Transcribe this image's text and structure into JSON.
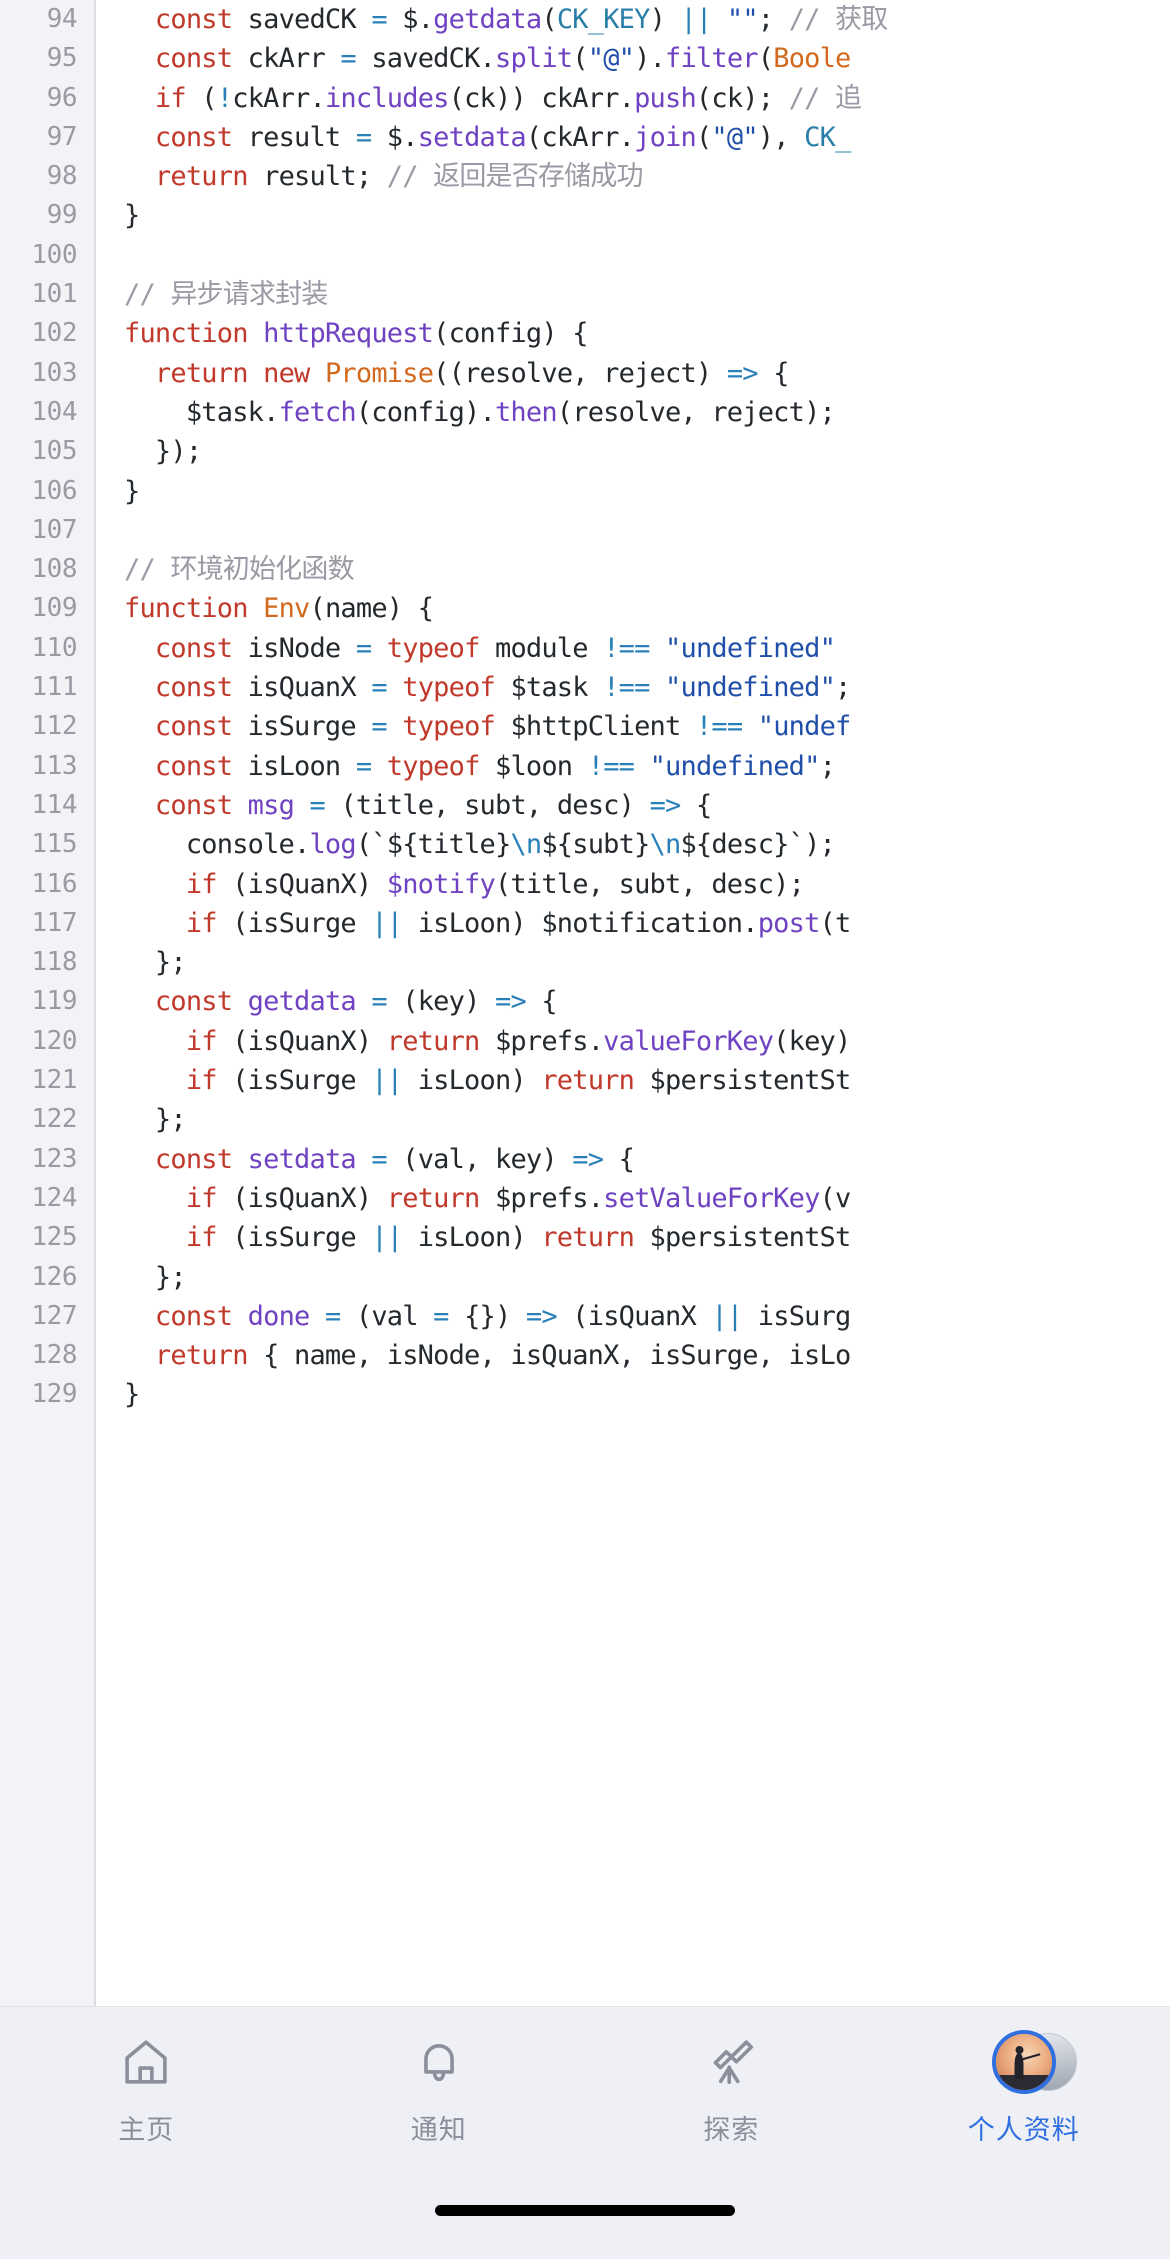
{
  "editor": {
    "first_line_number": 94,
    "lines": [
      {
        "n": 94,
        "tokens": [
          {
            "t": "  ",
            "c": "t-var"
          },
          {
            "t": "const",
            "c": "t-kw"
          },
          {
            "t": " savedCK ",
            "c": "t-var"
          },
          {
            "t": "=",
            "c": "t-op"
          },
          {
            "t": " $.",
            "c": "t-var"
          },
          {
            "t": "getdata",
            "c": "t-fn"
          },
          {
            "t": "(",
            "c": "t-var"
          },
          {
            "t": "CK_KEY",
            "c": "t-cnst"
          },
          {
            "t": ") ",
            "c": "t-var"
          },
          {
            "t": "||",
            "c": "t-op"
          },
          {
            "t": " ",
            "c": "t-var"
          },
          {
            "t": "\"\"",
            "c": "t-str"
          },
          {
            "t": "; ",
            "c": "t-var"
          },
          {
            "t": "// 获取",
            "c": "t-cmt"
          }
        ]
      },
      {
        "n": 95,
        "tokens": [
          {
            "t": "  ",
            "c": "t-var"
          },
          {
            "t": "const",
            "c": "t-kw"
          },
          {
            "t": " ckArr ",
            "c": "t-var"
          },
          {
            "t": "=",
            "c": "t-op"
          },
          {
            "t": " savedCK.",
            "c": "t-var"
          },
          {
            "t": "split",
            "c": "t-fn"
          },
          {
            "t": "(",
            "c": "t-var"
          },
          {
            "t": "\"@\"",
            "c": "t-str"
          },
          {
            "t": ").",
            "c": "t-var"
          },
          {
            "t": "filter",
            "c": "t-fn"
          },
          {
            "t": "(",
            "c": "t-var"
          },
          {
            "t": "Boole",
            "c": "t-cls"
          }
        ]
      },
      {
        "n": 96,
        "tokens": [
          {
            "t": "  ",
            "c": "t-var"
          },
          {
            "t": "if",
            "c": "t-kw"
          },
          {
            "t": " (",
            "c": "t-var"
          },
          {
            "t": "!",
            "c": "t-op"
          },
          {
            "t": "ckArr.",
            "c": "t-var"
          },
          {
            "t": "includes",
            "c": "t-fn"
          },
          {
            "t": "(ck)) ckArr.",
            "c": "t-var"
          },
          {
            "t": "push",
            "c": "t-fn"
          },
          {
            "t": "(ck); ",
            "c": "t-var"
          },
          {
            "t": "// 追",
            "c": "t-cmt"
          }
        ]
      },
      {
        "n": 97,
        "tokens": [
          {
            "t": "  ",
            "c": "t-var"
          },
          {
            "t": "const",
            "c": "t-kw"
          },
          {
            "t": " result ",
            "c": "t-var"
          },
          {
            "t": "=",
            "c": "t-op"
          },
          {
            "t": " $.",
            "c": "t-var"
          },
          {
            "t": "setdata",
            "c": "t-fn"
          },
          {
            "t": "(ckArr.",
            "c": "t-var"
          },
          {
            "t": "join",
            "c": "t-fn"
          },
          {
            "t": "(",
            "c": "t-var"
          },
          {
            "t": "\"@\"",
            "c": "t-str"
          },
          {
            "t": "), ",
            "c": "t-var"
          },
          {
            "t": "CK_",
            "c": "t-cnst"
          }
        ]
      },
      {
        "n": 98,
        "tokens": [
          {
            "t": "  ",
            "c": "t-var"
          },
          {
            "t": "return",
            "c": "t-kw"
          },
          {
            "t": " result; ",
            "c": "t-var"
          },
          {
            "t": "// 返回是否存储成功",
            "c": "t-cmt"
          }
        ]
      },
      {
        "n": 99,
        "tokens": [
          {
            "t": "}",
            "c": "t-var"
          }
        ]
      },
      {
        "n": 100,
        "tokens": []
      },
      {
        "n": 101,
        "tokens": [
          {
            "t": "// 异步请求封装",
            "c": "t-cmt"
          }
        ]
      },
      {
        "n": 102,
        "tokens": [
          {
            "t": "function",
            "c": "t-kw"
          },
          {
            "t": " ",
            "c": "t-var"
          },
          {
            "t": "httpRequest",
            "c": "t-fn"
          },
          {
            "t": "(config) {",
            "c": "t-var"
          }
        ]
      },
      {
        "n": 103,
        "tokens": [
          {
            "t": "  ",
            "c": "t-var"
          },
          {
            "t": "return",
            "c": "t-kw"
          },
          {
            "t": " ",
            "c": "t-var"
          },
          {
            "t": "new",
            "c": "t-kw"
          },
          {
            "t": " ",
            "c": "t-var"
          },
          {
            "t": "Promise",
            "c": "t-cls"
          },
          {
            "t": "((resolve, reject) ",
            "c": "t-var"
          },
          {
            "t": "=>",
            "c": "t-op"
          },
          {
            "t": " {",
            "c": "t-var"
          }
        ]
      },
      {
        "n": 104,
        "tokens": [
          {
            "t": "    $task.",
            "c": "t-var"
          },
          {
            "t": "fetch",
            "c": "t-fn"
          },
          {
            "t": "(config).",
            "c": "t-var"
          },
          {
            "t": "then",
            "c": "t-fn"
          },
          {
            "t": "(resolve, reject);",
            "c": "t-var"
          }
        ]
      },
      {
        "n": 105,
        "tokens": [
          {
            "t": "  });",
            "c": "t-var"
          }
        ]
      },
      {
        "n": 106,
        "tokens": [
          {
            "t": "}",
            "c": "t-var"
          }
        ]
      },
      {
        "n": 107,
        "tokens": []
      },
      {
        "n": 108,
        "tokens": [
          {
            "t": "// 环境初始化函数",
            "c": "t-cmt"
          }
        ]
      },
      {
        "n": 109,
        "tokens": [
          {
            "t": "function",
            "c": "t-kw"
          },
          {
            "t": " ",
            "c": "t-var"
          },
          {
            "t": "Env",
            "c": "t-cls"
          },
          {
            "t": "(name) {",
            "c": "t-var"
          }
        ]
      },
      {
        "n": 110,
        "tokens": [
          {
            "t": "  ",
            "c": "t-var"
          },
          {
            "t": "const",
            "c": "t-kw"
          },
          {
            "t": " isNode ",
            "c": "t-var"
          },
          {
            "t": "=",
            "c": "t-op"
          },
          {
            "t": " ",
            "c": "t-var"
          },
          {
            "t": "typeof",
            "c": "t-kw"
          },
          {
            "t": " module ",
            "c": "t-var"
          },
          {
            "t": "!==",
            "c": "t-op"
          },
          {
            "t": " ",
            "c": "t-var"
          },
          {
            "t": "\"undefined\"",
            "c": "t-str"
          }
        ]
      },
      {
        "n": 111,
        "tokens": [
          {
            "t": "  ",
            "c": "t-var"
          },
          {
            "t": "const",
            "c": "t-kw"
          },
          {
            "t": " isQuanX ",
            "c": "t-var"
          },
          {
            "t": "=",
            "c": "t-op"
          },
          {
            "t": " ",
            "c": "t-var"
          },
          {
            "t": "typeof",
            "c": "t-kw"
          },
          {
            "t": " $task ",
            "c": "t-var"
          },
          {
            "t": "!==",
            "c": "t-op"
          },
          {
            "t": " ",
            "c": "t-var"
          },
          {
            "t": "\"undefined\"",
            "c": "t-str"
          },
          {
            "t": ";",
            "c": "t-var"
          }
        ]
      },
      {
        "n": 112,
        "tokens": [
          {
            "t": "  ",
            "c": "t-var"
          },
          {
            "t": "const",
            "c": "t-kw"
          },
          {
            "t": " isSurge ",
            "c": "t-var"
          },
          {
            "t": "=",
            "c": "t-op"
          },
          {
            "t": " ",
            "c": "t-var"
          },
          {
            "t": "typeof",
            "c": "t-kw"
          },
          {
            "t": " $httpClient ",
            "c": "t-var"
          },
          {
            "t": "!==",
            "c": "t-op"
          },
          {
            "t": " ",
            "c": "t-var"
          },
          {
            "t": "\"undef",
            "c": "t-str"
          }
        ]
      },
      {
        "n": 113,
        "tokens": [
          {
            "t": "  ",
            "c": "t-var"
          },
          {
            "t": "const",
            "c": "t-kw"
          },
          {
            "t": " isLoon ",
            "c": "t-var"
          },
          {
            "t": "=",
            "c": "t-op"
          },
          {
            "t": " ",
            "c": "t-var"
          },
          {
            "t": "typeof",
            "c": "t-kw"
          },
          {
            "t": " $loon ",
            "c": "t-var"
          },
          {
            "t": "!==",
            "c": "t-op"
          },
          {
            "t": " ",
            "c": "t-var"
          },
          {
            "t": "\"undefined\"",
            "c": "t-str"
          },
          {
            "t": ";",
            "c": "t-var"
          }
        ]
      },
      {
        "n": 114,
        "tokens": [
          {
            "t": "  ",
            "c": "t-var"
          },
          {
            "t": "const",
            "c": "t-kw"
          },
          {
            "t": " ",
            "c": "t-var"
          },
          {
            "t": "msg",
            "c": "t-fn"
          },
          {
            "t": " ",
            "c": "t-var"
          },
          {
            "t": "=",
            "c": "t-op"
          },
          {
            "t": " (title, subt, desc) ",
            "c": "t-var"
          },
          {
            "t": "=>",
            "c": "t-op"
          },
          {
            "t": " {",
            "c": "t-var"
          }
        ]
      },
      {
        "n": 115,
        "tokens": [
          {
            "t": "    console.",
            "c": "t-var"
          },
          {
            "t": "log",
            "c": "t-fn"
          },
          {
            "t": "(`${title}",
            "c": "t-var"
          },
          {
            "t": "\\n",
            "c": "t-op"
          },
          {
            "t": "${subt}",
            "c": "t-var"
          },
          {
            "t": "\\n",
            "c": "t-op"
          },
          {
            "t": "${desc}`);",
            "c": "t-var"
          }
        ]
      },
      {
        "n": 116,
        "tokens": [
          {
            "t": "    ",
            "c": "t-var"
          },
          {
            "t": "if",
            "c": "t-kw"
          },
          {
            "t": " (isQuanX) ",
            "c": "t-var"
          },
          {
            "t": "$notify",
            "c": "t-fn"
          },
          {
            "t": "(title, subt, desc);",
            "c": "t-var"
          }
        ]
      },
      {
        "n": 117,
        "tokens": [
          {
            "t": "    ",
            "c": "t-var"
          },
          {
            "t": "if",
            "c": "t-kw"
          },
          {
            "t": " (isSurge ",
            "c": "t-var"
          },
          {
            "t": "||",
            "c": "t-op"
          },
          {
            "t": " isLoon) $notification.",
            "c": "t-var"
          },
          {
            "t": "post",
            "c": "t-fn"
          },
          {
            "t": "(t",
            "c": "t-var"
          }
        ]
      },
      {
        "n": 118,
        "tokens": [
          {
            "t": "  };",
            "c": "t-var"
          }
        ]
      },
      {
        "n": 119,
        "tokens": [
          {
            "t": "  ",
            "c": "t-var"
          },
          {
            "t": "const",
            "c": "t-kw"
          },
          {
            "t": " ",
            "c": "t-var"
          },
          {
            "t": "getdata",
            "c": "t-fn"
          },
          {
            "t": " ",
            "c": "t-var"
          },
          {
            "t": "=",
            "c": "t-op"
          },
          {
            "t": " (key) ",
            "c": "t-var"
          },
          {
            "t": "=>",
            "c": "t-op"
          },
          {
            "t": " {",
            "c": "t-var"
          }
        ]
      },
      {
        "n": 120,
        "tokens": [
          {
            "t": "    ",
            "c": "t-var"
          },
          {
            "t": "if",
            "c": "t-kw"
          },
          {
            "t": " (isQuanX) ",
            "c": "t-var"
          },
          {
            "t": "return",
            "c": "t-kw"
          },
          {
            "t": " $prefs.",
            "c": "t-var"
          },
          {
            "t": "valueForKey",
            "c": "t-fn"
          },
          {
            "t": "(key)",
            "c": "t-var"
          }
        ]
      },
      {
        "n": 121,
        "tokens": [
          {
            "t": "    ",
            "c": "t-var"
          },
          {
            "t": "if",
            "c": "t-kw"
          },
          {
            "t": " (isSurge ",
            "c": "t-var"
          },
          {
            "t": "||",
            "c": "t-op"
          },
          {
            "t": " isLoon) ",
            "c": "t-var"
          },
          {
            "t": "return",
            "c": "t-kw"
          },
          {
            "t": " $persistentSt",
            "c": "t-var"
          }
        ]
      },
      {
        "n": 122,
        "tokens": [
          {
            "t": "  };",
            "c": "t-var"
          }
        ]
      },
      {
        "n": 123,
        "tokens": [
          {
            "t": "  ",
            "c": "t-var"
          },
          {
            "t": "const",
            "c": "t-kw"
          },
          {
            "t": " ",
            "c": "t-var"
          },
          {
            "t": "setdata",
            "c": "t-fn"
          },
          {
            "t": " ",
            "c": "t-var"
          },
          {
            "t": "=",
            "c": "t-op"
          },
          {
            "t": " (val, key) ",
            "c": "t-var"
          },
          {
            "t": "=>",
            "c": "t-op"
          },
          {
            "t": " {",
            "c": "t-var"
          }
        ]
      },
      {
        "n": 124,
        "tokens": [
          {
            "t": "    ",
            "c": "t-var"
          },
          {
            "t": "if",
            "c": "t-kw"
          },
          {
            "t": " (isQuanX) ",
            "c": "t-var"
          },
          {
            "t": "return",
            "c": "t-kw"
          },
          {
            "t": " $prefs.",
            "c": "t-var"
          },
          {
            "t": "setValueForKey",
            "c": "t-fn"
          },
          {
            "t": "(v",
            "c": "t-var"
          }
        ]
      },
      {
        "n": 125,
        "tokens": [
          {
            "t": "    ",
            "c": "t-var"
          },
          {
            "t": "if",
            "c": "t-kw"
          },
          {
            "t": " (isSurge ",
            "c": "t-var"
          },
          {
            "t": "||",
            "c": "t-op"
          },
          {
            "t": " isLoon) ",
            "c": "t-var"
          },
          {
            "t": "return",
            "c": "t-kw"
          },
          {
            "t": " $persistentSt",
            "c": "t-var"
          }
        ]
      },
      {
        "n": 126,
        "tokens": [
          {
            "t": "  };",
            "c": "t-var"
          }
        ]
      },
      {
        "n": 127,
        "tokens": [
          {
            "t": "  ",
            "c": "t-var"
          },
          {
            "t": "const",
            "c": "t-kw"
          },
          {
            "t": " ",
            "c": "t-var"
          },
          {
            "t": "done",
            "c": "t-fn"
          },
          {
            "t": " ",
            "c": "t-var"
          },
          {
            "t": "=",
            "c": "t-op"
          },
          {
            "t": " (val ",
            "c": "t-var"
          },
          {
            "t": "=",
            "c": "t-op"
          },
          {
            "t": " {}) ",
            "c": "t-var"
          },
          {
            "t": "=>",
            "c": "t-op"
          },
          {
            "t": " (isQuanX ",
            "c": "t-var"
          },
          {
            "t": "||",
            "c": "t-op"
          },
          {
            "t": " isSurg",
            "c": "t-var"
          }
        ]
      },
      {
        "n": 128,
        "tokens": [
          {
            "t": "  ",
            "c": "t-var"
          },
          {
            "t": "return",
            "c": "t-kw"
          },
          {
            "t": " { name, isNode, isQuanX, isSurge, isLo",
            "c": "t-var"
          }
        ]
      },
      {
        "n": 129,
        "tokens": [
          {
            "t": "}",
            "c": "t-var"
          }
        ]
      }
    ]
  },
  "tabbar": {
    "items": [
      {
        "id": "home",
        "label": "主页",
        "icon": "home-icon",
        "active": false
      },
      {
        "id": "notify",
        "label": "通知",
        "icon": "bell-icon",
        "active": false
      },
      {
        "id": "explore",
        "label": "探索",
        "icon": "telescope-icon",
        "active": false
      },
      {
        "id": "profile",
        "label": "个人资料",
        "icon": "avatar",
        "active": true
      }
    ],
    "active_color": "#2f6fe0",
    "inactive_color": "#8b8f9c",
    "background": "#eef0f5"
  }
}
